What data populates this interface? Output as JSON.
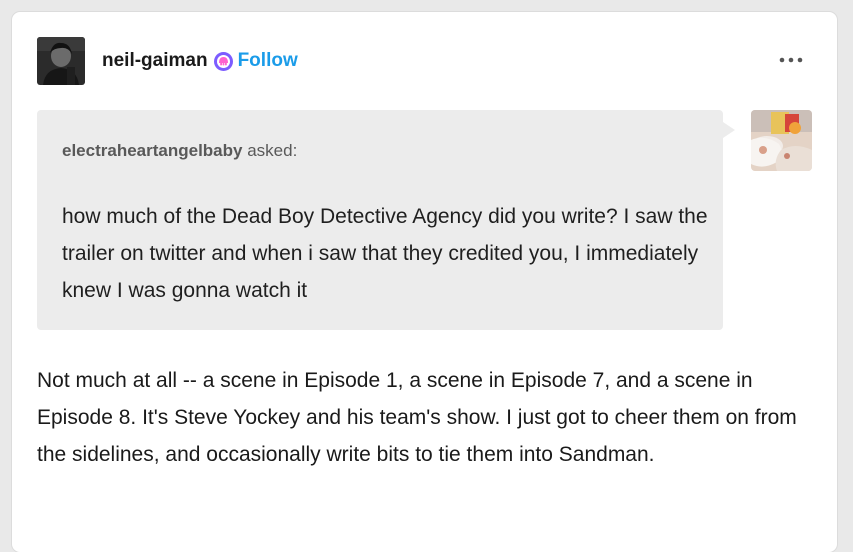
{
  "post": {
    "blog_name": "neil-gaiman",
    "follow_label": "Follow",
    "more_label": "•••",
    "ask": {
      "asker": "electraheartangelbaby",
      "asked_label": "asked:",
      "question": "how much of the Dead Boy Detective Agency did you write? I saw the trailer on twitter and when i saw that they credited you, I immediately knew I was gonna watch it"
    },
    "answer": "Not much at all --  a scene in Episode 1, a scene in Episode 7, and a scene in Episode 8.  It's Steve Yockey and his team's show. I just got to cheer them on from the sidelines, and occasionally write bits to tie them into Sandman."
  },
  "icons": {
    "badge": "tumblr-supporter-badge-icon",
    "more": "more-horizontal-icon"
  },
  "colors": {
    "follow": "#1b9ce9",
    "badge": "#7c5cff",
    "ask_bubble": "#ececec"
  }
}
